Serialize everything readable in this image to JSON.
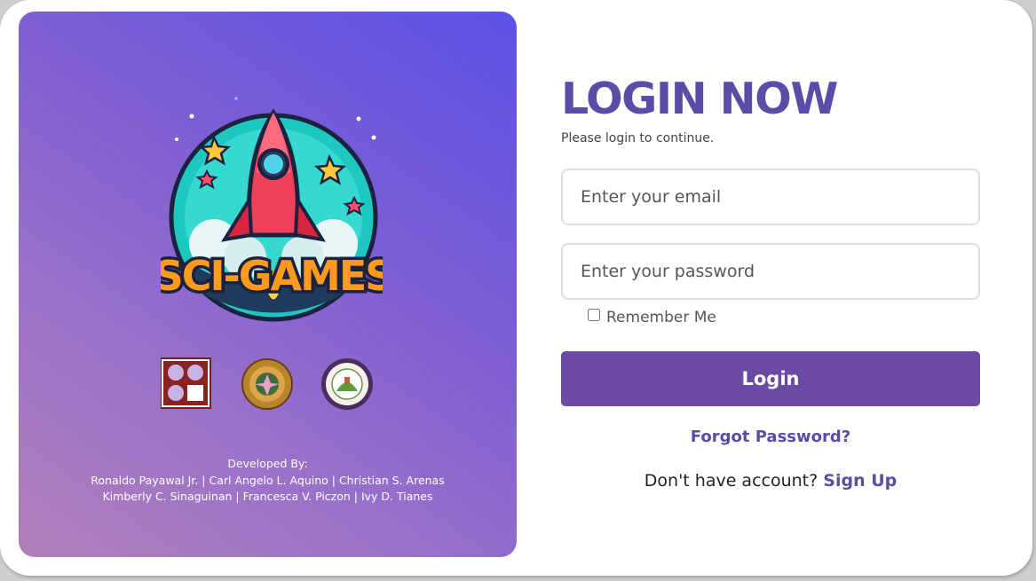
{
  "left": {
    "logo_text": "SCI-GAMES",
    "credits": {
      "heading": "Developed By:",
      "line1": "Ronaldo Payawal Jr. | Carl Angelo L. Aquino | Christian S. Arenas",
      "line2": "Kimberly C. Sinaguinan | Francesca V. Piczon | Ivy D. Tianes"
    }
  },
  "login": {
    "title": "LOGIN NOW",
    "subtitle": "Please login to continue.",
    "email_placeholder": "Enter your email",
    "password_placeholder": "Enter your password",
    "remember_label": "Remember Me",
    "button_label": "Login",
    "forgot_label": "Forgot Password?",
    "no_account_text": "Don't have account?",
    "signup_label": "Sign Up"
  },
  "colors": {
    "accent": "#5d4ba8",
    "button": "#6b4aa3",
    "panel_gradient_start": "#b27fb8",
    "panel_gradient_end": "#5b52e6"
  }
}
